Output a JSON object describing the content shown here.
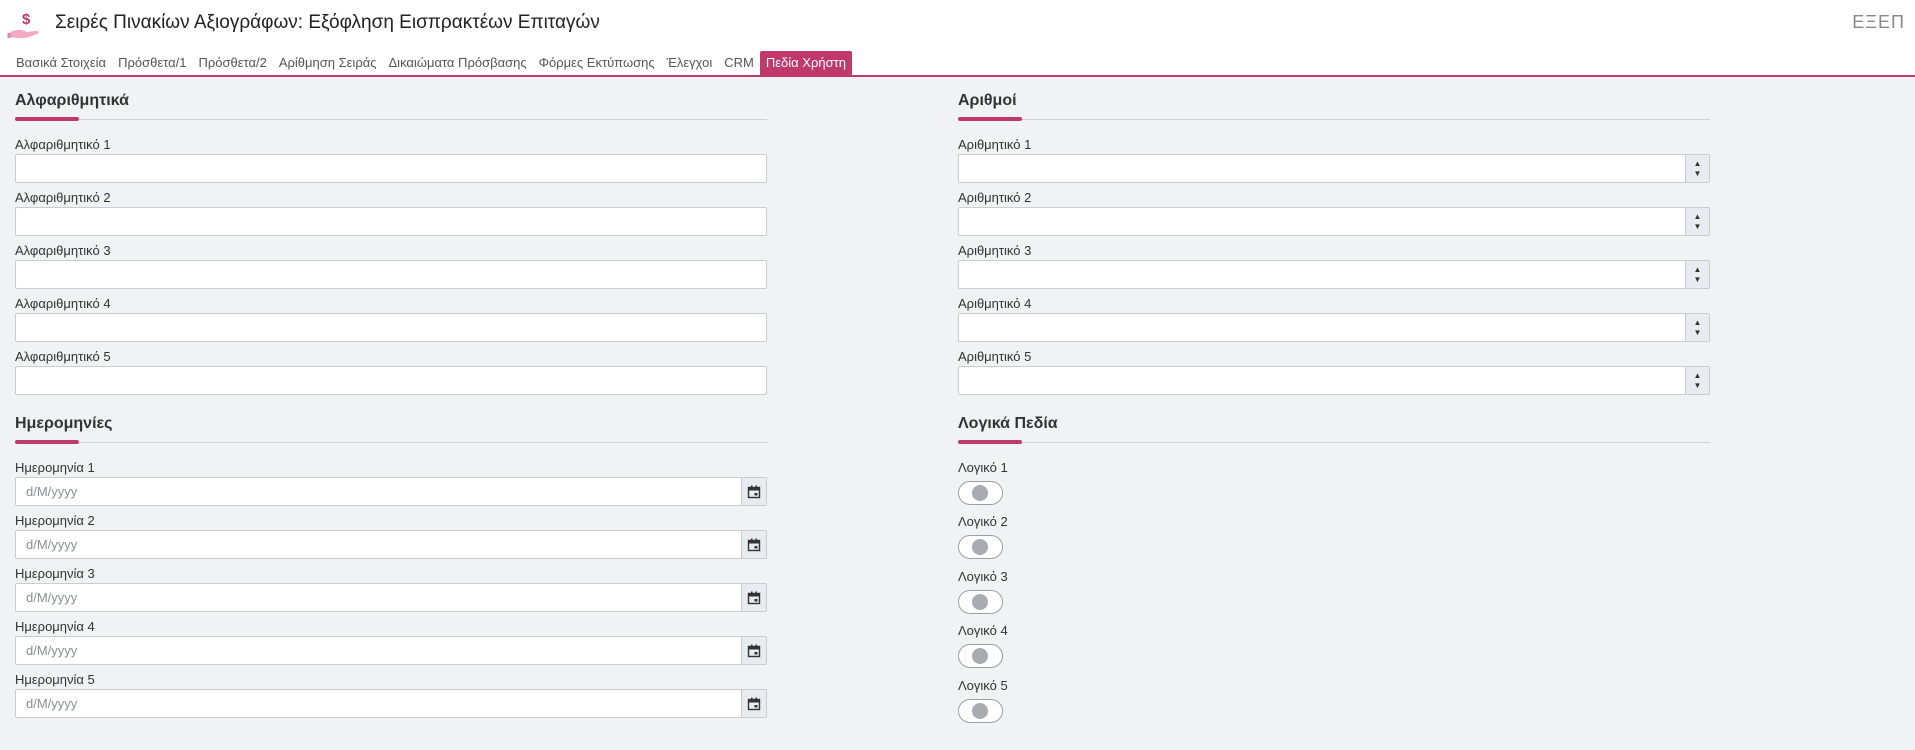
{
  "app": {
    "title": "Σειρές Πινακίων Αξιογράφων: Εξόφληση Εισπρακτέων Επιταγών",
    "code": "ΕΞΕΠ"
  },
  "tabs": [
    {
      "label": "Βασικά Στοιχεία"
    },
    {
      "label": "Πρόσθετα/1"
    },
    {
      "label": "Πρόσθετα/2"
    },
    {
      "label": "Αρίθμηση Σειράς"
    },
    {
      "label": "Δικαιώματα Πρόσβασης"
    },
    {
      "label": "Φόρμες Εκτύπωσης"
    },
    {
      "label": "Έλεγχοι"
    },
    {
      "label": "CRM"
    },
    {
      "label": "Πεδία Χρήστη"
    }
  ],
  "active_tab": "Πεδία Χρήστη",
  "accent_color": "#c0396b",
  "alpha": {
    "title": "Αλφαριθμητικά",
    "fields": [
      {
        "label": "Αλφαριθμητικό 1",
        "value": ""
      },
      {
        "label": "Αλφαριθμητικό 2",
        "value": ""
      },
      {
        "label": "Αλφαριθμητικό 3",
        "value": ""
      },
      {
        "label": "Αλφαριθμητικό 4",
        "value": ""
      },
      {
        "label": "Αλφαριθμητικό 5",
        "value": ""
      }
    ]
  },
  "numbers": {
    "title": "Αριθμοί",
    "fields": [
      {
        "label": "Αριθμητικό 1",
        "value": ""
      },
      {
        "label": "Αριθμητικό 2",
        "value": ""
      },
      {
        "label": "Αριθμητικό 3",
        "value": ""
      },
      {
        "label": "Αριθμητικό 4",
        "value": ""
      },
      {
        "label": "Αριθμητικό 5",
        "value": ""
      }
    ]
  },
  "dates": {
    "title": "Ημερομηνίες",
    "placeholder": "d/M/yyyy",
    "fields": [
      {
        "label": "Ημερομηνία 1"
      },
      {
        "label": "Ημερομηνία 2"
      },
      {
        "label": "Ημερομηνία 3"
      },
      {
        "label": "Ημερομηνία 4"
      },
      {
        "label": "Ημερομηνία 5"
      }
    ]
  },
  "logical": {
    "title": "Λογικά Πεδία",
    "fields": [
      {
        "label": "Λογικό 1",
        "checked": false
      },
      {
        "label": "Λογικό 2",
        "checked": false
      },
      {
        "label": "Λογικό 3",
        "checked": false
      },
      {
        "label": "Λογικό 4",
        "checked": false
      },
      {
        "label": "Λογικό 5",
        "checked": false
      }
    ]
  }
}
